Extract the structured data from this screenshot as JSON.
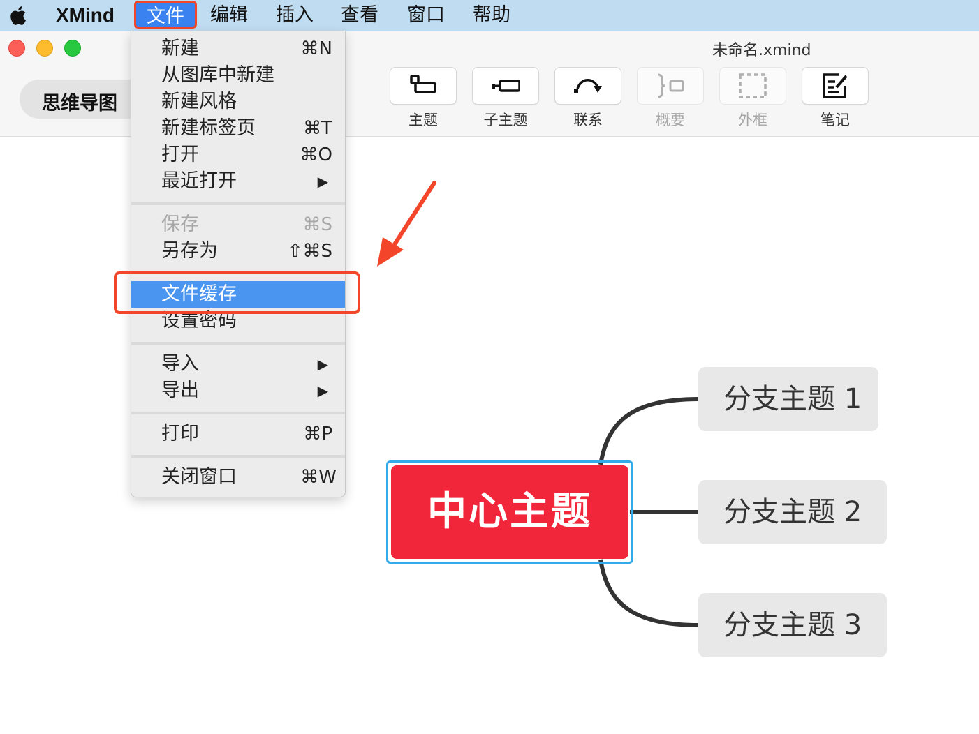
{
  "menubar": {
    "app_name": "XMind",
    "file": "文件",
    "edit": "编辑",
    "insert": "插入",
    "view": "查看",
    "window": "窗口",
    "help": "帮助"
  },
  "window": {
    "title": "未命名.xmind",
    "tab": "思维导图"
  },
  "toolbar": {
    "topic": "主题",
    "subtopic": "子主题",
    "relationship": "联系",
    "summary": "概要",
    "boundary": "外框",
    "notes": "笔记"
  },
  "file_menu": {
    "new": {
      "label": "新建",
      "shortcut": "⌘N"
    },
    "new_from_library": {
      "label": "从图库中新建"
    },
    "new_style": {
      "label": "新建风格"
    },
    "new_tab": {
      "label": "新建标签页",
      "shortcut": "⌘T"
    },
    "open": {
      "label": "打开",
      "shortcut": "⌘O"
    },
    "open_recent": {
      "label": "最近打开"
    },
    "save": {
      "label": "保存",
      "shortcut": "⌘S"
    },
    "save_as": {
      "label": "另存为",
      "shortcut": "⇧⌘S"
    },
    "file_cache": {
      "label": "文件缓存"
    },
    "set_password": {
      "label": "设置密码"
    },
    "import": {
      "label": "导入"
    },
    "export": {
      "label": "导出"
    },
    "print": {
      "label": "打印",
      "shortcut": "⌘P"
    },
    "close_window": {
      "label": "关闭窗口",
      "shortcut": "⌘W"
    }
  },
  "mindmap": {
    "central": "中心主题",
    "branches": [
      "分支主题 1",
      "分支主题 2",
      "分支主题 3"
    ]
  },
  "colors": {
    "central_topic": "#f2263a",
    "selection": "#33aaea",
    "menu_highlight": "#4a95f0",
    "annotation": "#f2452a"
  }
}
